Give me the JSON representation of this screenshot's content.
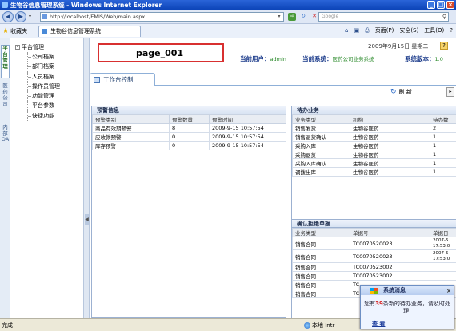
{
  "window": {
    "title": "生物谷信息管理系统 - Windows Internet Explorer"
  },
  "browser": {
    "url": "http://localhost/EMIS/Web/main.aspx",
    "search_placeholder": "Google",
    "favorites_label": "收藏夹",
    "tab_label": "生物谷信息管理系统",
    "commands": {
      "page": "页面(P)",
      "safety": "安全(S)",
      "tools": "工具(O)",
      "help": "?"
    }
  },
  "vtabs": [
    {
      "label": "平台管理"
    },
    {
      "label": "医药公司"
    },
    {
      "label": "内部OA"
    }
  ],
  "tree": {
    "root": "平台管理",
    "items": [
      {
        "label": "公司档案"
      },
      {
        "label": "部门档案"
      },
      {
        "label": "人员档案"
      },
      {
        "label": "操作员管理"
      },
      {
        "label": "功能管理"
      },
      {
        "label": "平台参数"
      },
      {
        "label": "快捷功能"
      }
    ]
  },
  "header": {
    "page_id": "page_001",
    "date": "2009年9月15日 星期二",
    "current_user_label": "当前用户：",
    "current_user": "admin",
    "current_system_label": "当前系统：",
    "current_system": "医药公司业务系统",
    "version_label": "系统版本：",
    "version": "1.0"
  },
  "workspace": {
    "tab_label": "工作台控制",
    "refresh_label": "刷 新"
  },
  "warning_panel": {
    "title": "预警信息",
    "columns": [
      "预警类别",
      "预警数量",
      "预警时间"
    ],
    "rows": [
      {
        "type": "商品有效期预警",
        "count": "8",
        "time": "2009-9-15 10:57:54"
      },
      {
        "type": "应收款预警",
        "count": "0",
        "time": "2009-9-15 10:57:54"
      },
      {
        "type": "库存预警",
        "count": "0",
        "time": "2009-9-15 10:57:54"
      }
    ]
  },
  "todo_panel": {
    "title": "待办业务",
    "columns": [
      "业务类型",
      "机构",
      "待办数"
    ],
    "rows": [
      {
        "type": "销售发货",
        "org": "生物谷医药",
        "count": "2"
      },
      {
        "type": "销售退货确认",
        "org": "生物谷医药",
        "count": "1"
      },
      {
        "type": "采购入库",
        "org": "生物谷医药",
        "count": "1"
      },
      {
        "type": "采购退货",
        "org": "生物谷医药",
        "count": "1"
      },
      {
        "type": "采购入库确认",
        "org": "生物谷医药",
        "count": "1"
      },
      {
        "type": "调拨出库",
        "org": "生物谷医药",
        "count": "1"
      }
    ]
  },
  "reject_panel": {
    "title": "确认拒绝单据",
    "columns": [
      "业务类型",
      "单据号",
      "单据日"
    ],
    "rows": [
      {
        "type": "销售合同",
        "no": "TC0070520023",
        "date1": "2007-5",
        "date2": "17:53:0"
      },
      {
        "type": "销售合同",
        "no": "TC0070520023",
        "date1": "2007-5",
        "date2": "17:53:0"
      },
      {
        "type": "销售合同",
        "no": "TC0070523002",
        "date1": "",
        "date2": ""
      },
      {
        "type": "销售合同",
        "no": "TC0070523002",
        "date1": "",
        "date2": ""
      },
      {
        "type": "销售合同",
        "no": "TC",
        "date1": "",
        "date2": ""
      },
      {
        "type": "销售合同",
        "no": "TC",
        "date1": "",
        "date2": ""
      }
    ]
  },
  "statusbar": {
    "left": "完成",
    "zone": "本地 Intr"
  },
  "popup": {
    "title": "系统消息",
    "msg_pre": "您有",
    "msg_count": "39",
    "msg_post": "条新的待办业务，请及时处理!",
    "link": "查 看"
  }
}
